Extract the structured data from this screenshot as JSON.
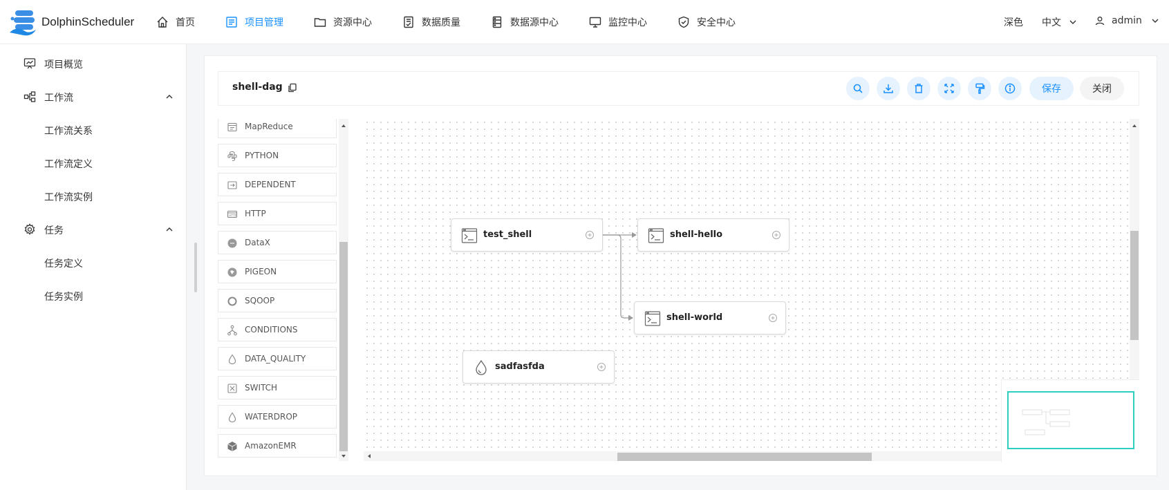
{
  "app": {
    "brand": "DolphinScheduler",
    "accent_color": "#1890ff"
  },
  "nav": {
    "items": [
      {
        "label": "首页",
        "icon": "home-icon",
        "active": false
      },
      {
        "label": "项目管理",
        "icon": "project-icon",
        "active": true
      },
      {
        "label": "资源中心",
        "icon": "folder-icon",
        "active": false
      },
      {
        "label": "数据质量",
        "icon": "data-quality-icon",
        "active": false
      },
      {
        "label": "数据源中心",
        "icon": "datasource-icon",
        "active": false
      },
      {
        "label": "监控中心",
        "icon": "monitor-icon",
        "active": false
      },
      {
        "label": "安全中心",
        "icon": "security-icon",
        "active": false
      }
    ],
    "theme_label": "深色",
    "lang_label": "中文",
    "user_label": "admin"
  },
  "sidebar": {
    "items": [
      {
        "label": "项目概览",
        "icon": "overview-icon"
      },
      {
        "label": "工作流",
        "icon": "workflow-icon"
      },
      {
        "label": "工作流关系"
      },
      {
        "label": "工作流定义"
      },
      {
        "label": "工作流实例"
      },
      {
        "label": "任务",
        "icon": "gear-icon"
      },
      {
        "label": "任务定义"
      },
      {
        "label": "任务实例"
      }
    ]
  },
  "dag": {
    "title": "shell-dag",
    "save_label": "保存",
    "close_label": "关闭",
    "tools": [
      "search-icon",
      "download-icon",
      "delete-icon",
      "fullscreen-icon",
      "format-icon",
      "info-icon"
    ]
  },
  "palette": {
    "items": [
      "MapReduce",
      "PYTHON",
      "DEPENDENT",
      "HTTP",
      "DataX",
      "PIGEON",
      "SQOOP",
      "CONDITIONS",
      "DATA_QUALITY",
      "SWITCH",
      "WATERDROP",
      "AmazonEMR"
    ]
  },
  "nodes": [
    {
      "label": "test_shell",
      "type": "shell"
    },
    {
      "label": "shell-hello",
      "type": "shell"
    },
    {
      "label": "shell-world",
      "type": "shell"
    },
    {
      "label": "sadfasfda",
      "type": "waterdrop"
    }
  ]
}
